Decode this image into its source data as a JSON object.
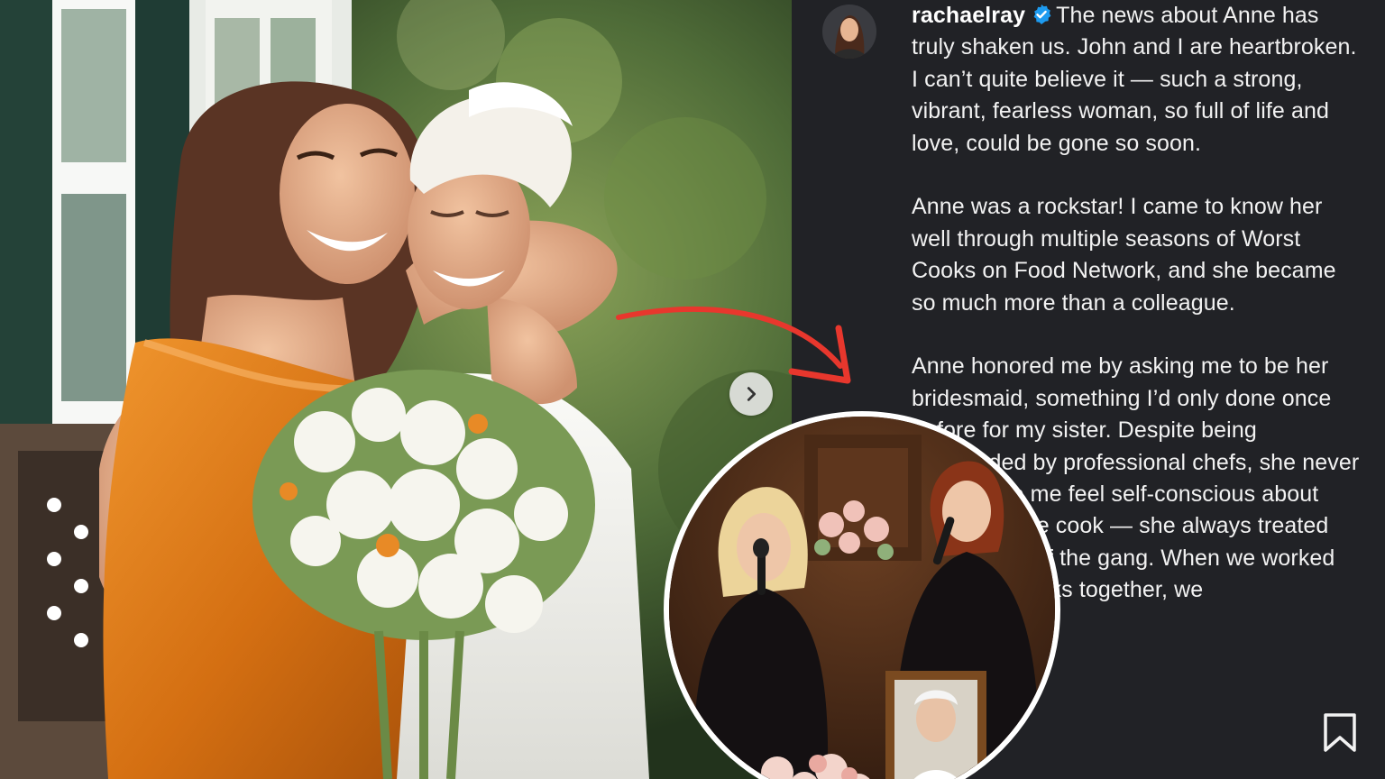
{
  "post": {
    "username": "rachaelray",
    "verified": true,
    "caption_paragraphs": [
      "The news about Anne has truly shaken us. John and I are heartbroken. I can’t quite believe it — such a strong, vibrant, fearless woman, so full of life and love, could be gone so soon.",
      "Anne was a rockstar! I came to know her well through multiple seasons of Worst Cooks on Food Network, and she became so much more than a colleague.",
      "Anne honored me by asking me to be her bridesmaid, something I’d only done once before for my sister. Despite being surrounded by professional chefs, she never once made me feel self-conscious about being a home cook — she always treated me like one of the gang. When we worked on Worst Cooks together, we"
    ]
  },
  "icons": {
    "verified": "verified-badge-icon",
    "carousel_next": "chevron-right-icon",
    "bookmark": "bookmark-icon",
    "arrow": "curved-arrow-icon"
  },
  "colors": {
    "caption_bg": "#212226",
    "caption_text": "#f2f2f2",
    "verified": "#1d9bf0",
    "arrow": "#e8372d",
    "dress_orange": "#e07e1b"
  }
}
